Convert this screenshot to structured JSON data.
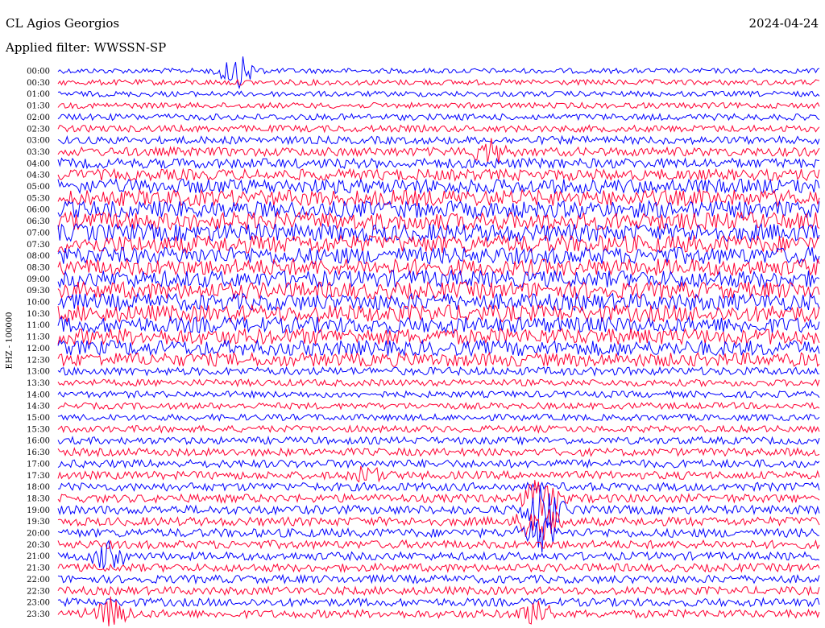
{
  "header": {
    "station": "CL Agios Georgios",
    "date": "2024-04-24",
    "filter": "Applied filter: WWSSN-SP"
  },
  "chart_data": {
    "type": "line",
    "ylabel": "EHZ - 100000",
    "row_labels": [
      "00:00",
      "00:30",
      "01:00",
      "01:30",
      "02:00",
      "02:30",
      "03:00",
      "03:30",
      "04:00",
      "04:30",
      "05:00",
      "05:30",
      "06:00",
      "06:30",
      "07:00",
      "07:30",
      "08:00",
      "08:30",
      "09:00",
      "09:30",
      "10:00",
      "10:30",
      "11:00",
      "11:30",
      "12:00",
      "12:30",
      "13:00",
      "13:30",
      "14:00",
      "14:30",
      "15:00",
      "15:30",
      "16:00",
      "16:30",
      "17:00",
      "17:30",
      "18:00",
      "18:30",
      "19:00",
      "19:30",
      "20:00",
      "20:30",
      "21:00",
      "21:30",
      "22:00",
      "22:30",
      "23:00",
      "23:30"
    ],
    "series_colors": [
      "#0000ff",
      "#ff0033"
    ],
    "row_noise_level": [
      0.12,
      0.15,
      0.14,
      0.16,
      0.2,
      0.22,
      0.28,
      0.35,
      0.42,
      0.5,
      0.7,
      0.8,
      0.85,
      0.9,
      0.9,
      0.9,
      0.85,
      0.85,
      0.85,
      0.85,
      0.85,
      0.85,
      0.8,
      0.8,
      0.75,
      0.65,
      0.3,
      0.22,
      0.2,
      0.2,
      0.2,
      0.22,
      0.25,
      0.28,
      0.3,
      0.3,
      0.32,
      0.32,
      0.34,
      0.34,
      0.34,
      0.32,
      0.3,
      0.3,
      0.3,
      0.3,
      0.3,
      0.3
    ],
    "events": [
      {
        "row": "00:00",
        "minute": 7,
        "amplitude": 2.2
      },
      {
        "row": "03:30",
        "minute": 17,
        "amplitude": 1.8
      },
      {
        "row": "17:30",
        "minute": 12,
        "amplitude": 1.4
      },
      {
        "row": "18:30",
        "minute": 19,
        "amplitude": 3.0
      },
      {
        "row": "19:00",
        "minute": 19,
        "amplitude": 3.2
      },
      {
        "row": "19:30",
        "minute": 19,
        "amplitude": 3.0
      },
      {
        "row": "20:00",
        "minute": 19,
        "amplitude": 2.4
      },
      {
        "row": "21:00",
        "minute": 2,
        "amplitude": 1.6
      },
      {
        "row": "23:30",
        "minute": 2,
        "amplitude": 2.0
      },
      {
        "row": "23:30",
        "minute": 19,
        "amplitude": 2.4
      }
    ]
  }
}
